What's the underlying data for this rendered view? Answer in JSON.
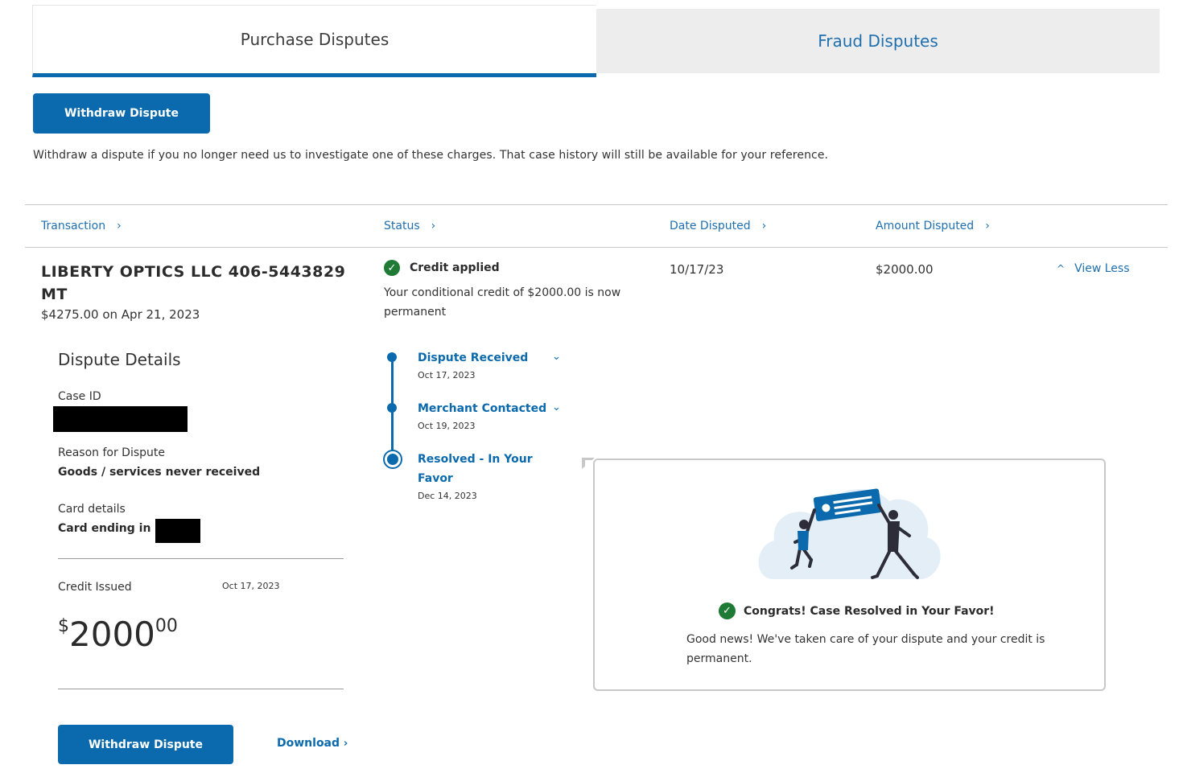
{
  "tabs": {
    "purchase": "Purchase Disputes",
    "fraud": "Fraud Disputes"
  },
  "actions": {
    "withdraw_top": "Withdraw Dispute",
    "withdraw_bottom": "Withdraw Dispute",
    "download": "Download",
    "view_less": "View Less"
  },
  "intro_text": "Withdraw a dispute if you no longer need us to investigate one of these charges. That case history will still be available for your reference.",
  "columns": {
    "transaction": "Transaction",
    "status": "Status",
    "date_disputed": "Date Disputed",
    "amount_disputed": "Amount Disputed"
  },
  "dispute": {
    "merchant": "LIBERTY OPTICS LLC 406-5443829 MT",
    "charge": "$4275.00 on Apr 21, 2023",
    "status_label": "Credit applied",
    "status_desc": "Your conditional credit of $2000.00 is now permanent",
    "date_disputed": "10/17/23",
    "amount_disputed": "$2000.00"
  },
  "details": {
    "title": "Dispute Details",
    "case_id_label": "Case ID",
    "reason_label": "Reason for Dispute",
    "reason_value": "Goods / services never received",
    "card_label": "Card details",
    "card_value": "Card ending in -",
    "credit_label": "Credit Issued",
    "credit_date": "Oct 17, 2023",
    "credit_currency": "$",
    "credit_whole": "2000",
    "credit_cents": "00"
  },
  "timeline": [
    {
      "title": "Dispute Received",
      "date": "Oct 17, 2023"
    },
    {
      "title": "Merchant Contacted",
      "date": "Oct 19, 2023"
    },
    {
      "title_line1": "Resolved - In Your",
      "title_line2": "Favor",
      "date": "Dec 14, 2023"
    }
  ],
  "popover": {
    "title": "Congrats! Case Resolved in Your Favor!",
    "text": "Good news! We've taken care of your dispute and your credit is permanent."
  },
  "icons": {
    "check": "check-circle-icon",
    "chevron_right": "chevron-right-icon",
    "chevron_down": "chevron-down-icon",
    "chevron_up": "chevron-up-icon"
  },
  "colors": {
    "primary": "#0b6aad",
    "success": "#1e7a34",
    "tab_inactive_bg": "#ededed"
  }
}
